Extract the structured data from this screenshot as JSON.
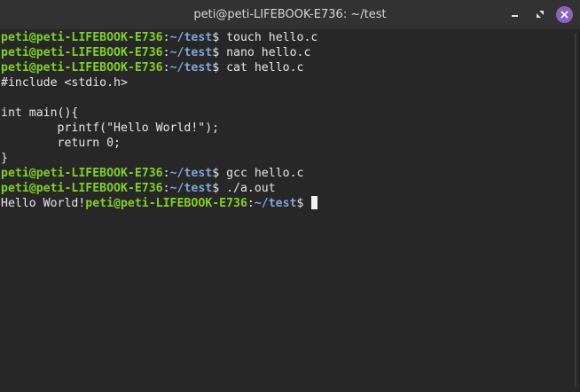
{
  "window": {
    "title": "peti@peti-LIFEBOOK-E736: ~/test",
    "buttons": {
      "minimize_icon": "minimize-icon",
      "maximize_icon": "maximize-icon",
      "close_icon": "close-icon"
    }
  },
  "colors": {
    "user_host": "#7ed321",
    "path": "#7aa6da",
    "text": "#e6e6e6",
    "background": "#272727",
    "close_button": "#8b63c6"
  },
  "terminal": {
    "user_host": "peti@peti-LIFEBOOK-E736",
    "sep": ":",
    "path": "~/test",
    "prompt_symbol": "$",
    "lines": [
      {
        "type": "prompt",
        "command": " touch hello.c"
      },
      {
        "type": "prompt",
        "command": " nano hello.c"
      },
      {
        "type": "prompt",
        "command": " cat hello.c"
      },
      {
        "type": "output",
        "text": "#include <stdio.h>"
      },
      {
        "type": "output",
        "text": ""
      },
      {
        "type": "output",
        "text": "int main(){"
      },
      {
        "type": "output",
        "text": "        printf(\"Hello World!\");"
      },
      {
        "type": "output",
        "text": "        return 0;"
      },
      {
        "type": "output",
        "text": "}"
      },
      {
        "type": "prompt",
        "command": " gcc hello.c"
      },
      {
        "type": "prompt",
        "command": " ./a.out"
      },
      {
        "type": "output_prompt",
        "text": "Hello World!",
        "command": " "
      }
    ]
  }
}
